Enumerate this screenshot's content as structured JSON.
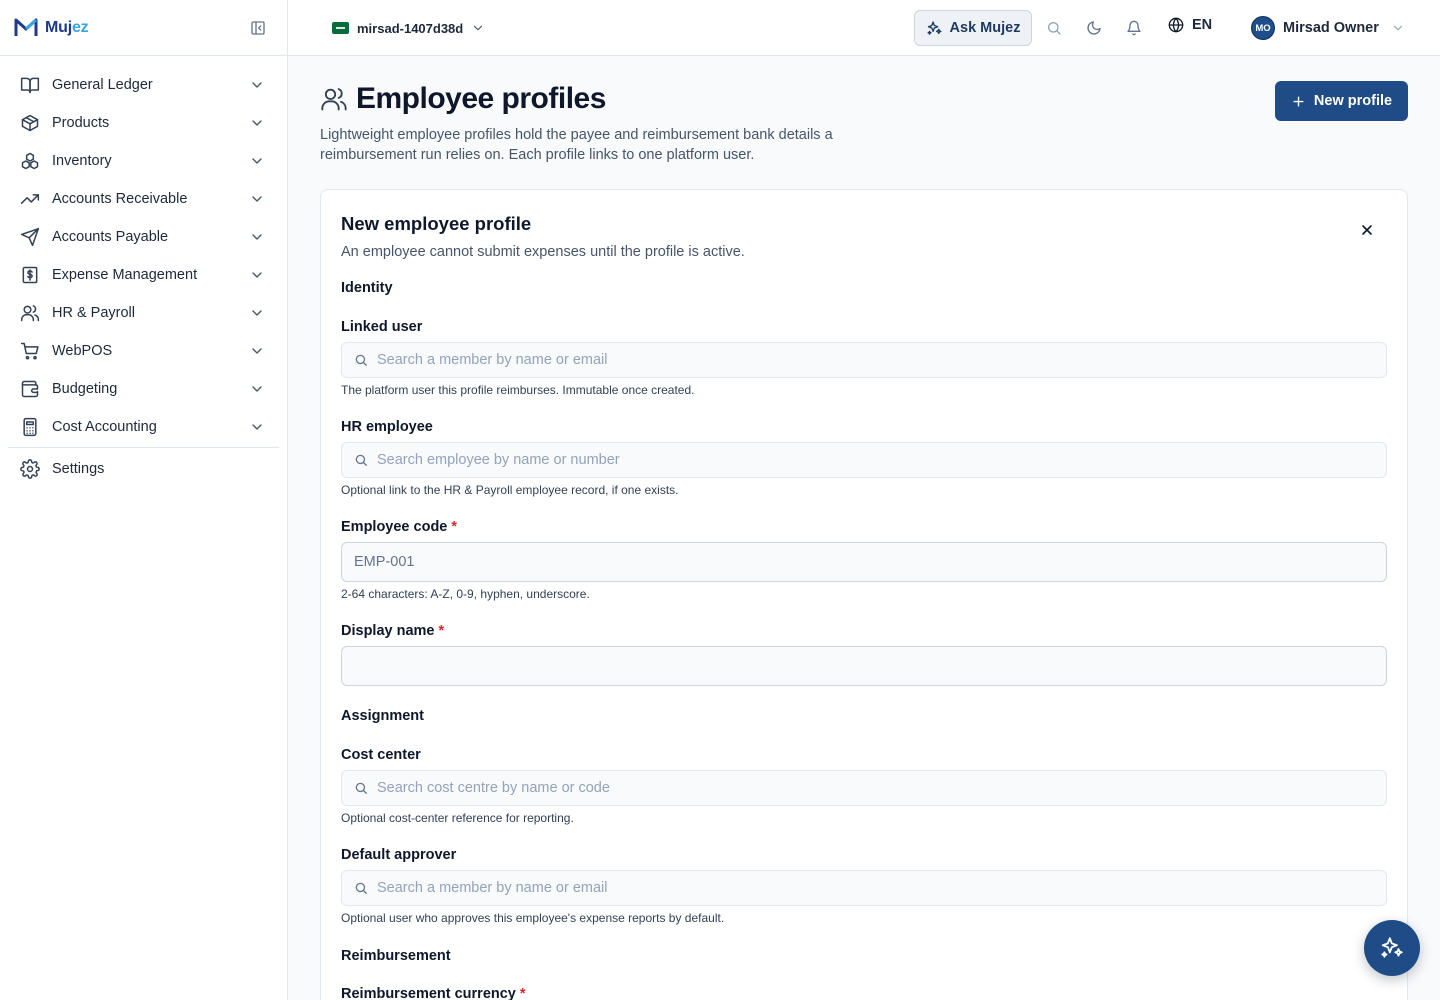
{
  "brand": {
    "name_main": "Muj",
    "name_accent": "ez"
  },
  "sidebar": {
    "items": [
      {
        "label": "General Ledger"
      },
      {
        "label": "Products"
      },
      {
        "label": "Inventory"
      },
      {
        "label": "Accounts Receivable"
      },
      {
        "label": "Accounts Payable"
      },
      {
        "label": "Expense Management"
      },
      {
        "label": "HR & Payroll"
      },
      {
        "label": "WebPOS"
      },
      {
        "label": "Budgeting"
      },
      {
        "label": "Cost Accounting"
      }
    ],
    "settings_label": "Settings"
  },
  "topbar": {
    "org_name": "mirsad-1407d38d",
    "ask_label": "Ask Mujez",
    "language": "EN",
    "user_initials": "MO",
    "user_name": "Mirsad Owner"
  },
  "page": {
    "title": "Employee profiles",
    "description": "Lightweight employee profiles hold the payee and reimbursement bank details a reimbursement run relies on. Each profile links to one platform user.",
    "new_button_label": "New profile"
  },
  "form": {
    "title": "New employee profile",
    "subtitle": "An employee cannot submit expenses until the profile is active.",
    "sections": {
      "identity": "Identity",
      "assignment": "Assignment",
      "reimbursement": "Reimbursement"
    },
    "linked_user": {
      "label": "Linked user",
      "placeholder": "Search a member by name or email",
      "help": "The platform user this profile reimburses. Immutable once created."
    },
    "hr_employee": {
      "label": "HR employee",
      "placeholder": "Search employee by name or number",
      "help": "Optional link to the HR & Payroll employee record, if one exists."
    },
    "employee_code": {
      "label": "Employee code",
      "required_mark": "*",
      "placeholder": "EMP-001",
      "help": "2-64 characters: A-Z, 0-9, hyphen, underscore."
    },
    "display_name": {
      "label": "Display name",
      "required_mark": "*",
      "value": ""
    },
    "cost_center": {
      "label": "Cost center",
      "placeholder": "Search cost centre by name or code",
      "help": "Optional cost-center reference for reporting."
    },
    "default_approver": {
      "label": "Default approver",
      "placeholder": "Search a member by name or email",
      "help": "Optional user who approves this employee's expense reports by default."
    },
    "reimbursement_currency": {
      "label": "Reimbursement currency",
      "required_mark": "*"
    }
  },
  "colors": {
    "primary": "#1f4c86",
    "brand_dark": "#1e3a8a",
    "brand_accent": "#38a5e0",
    "required": "#dc2626"
  },
  "icons": {
    "sidebar": [
      "book-open-icon",
      "package-icon",
      "boxes-icon",
      "trending-up-icon",
      "send-icon",
      "receipt-dollar-icon",
      "users-icon",
      "shopping-cart-icon",
      "wallet-icon",
      "calculator-icon",
      "gear-icon"
    ],
    "topbar": [
      "panel-left-collapse-icon",
      "sparkles-icon",
      "search-icon",
      "moon-icon",
      "bell-icon",
      "globe-icon",
      "chevron-down-icon"
    ]
  }
}
